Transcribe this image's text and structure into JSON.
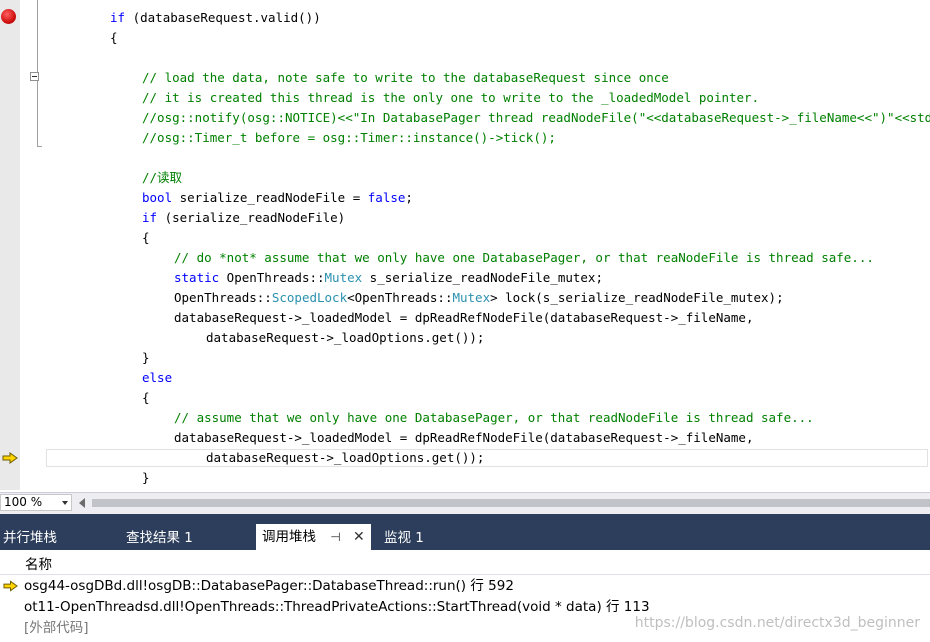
{
  "editor": {
    "lines": [
      {
        "indent": 64,
        "segments": [
          {
            "t": "if",
            "c": "kw"
          },
          {
            "t": " (databaseRequest.valid())"
          }
        ]
      },
      {
        "indent": 64,
        "segments": [
          {
            "t": "{"
          }
        ]
      },
      {
        "indent": 0,
        "segments": []
      },
      {
        "indent": 96,
        "segments": [
          {
            "t": "// load the data, note safe to write to the databaseRequest since once",
            "c": "cm"
          }
        ]
      },
      {
        "indent": 96,
        "segments": [
          {
            "t": "// it is created this thread is the only one to write to the _loadedModel pointer.",
            "c": "cm"
          }
        ]
      },
      {
        "indent": 96,
        "segments": [
          {
            "t": "//osg::notify(osg::NOTICE)<<\"In DatabasePager thread readNodeFile(\"<<databaseRequest->_fileName<<\")\"<<std::endl;",
            "c": "cm"
          }
        ]
      },
      {
        "indent": 96,
        "segments": [
          {
            "t": "//osg::Timer_t before = osg::Timer::instance()->tick();",
            "c": "cm"
          }
        ]
      },
      {
        "indent": 0,
        "segments": []
      },
      {
        "indent": 96,
        "segments": [
          {
            "t": "//读取",
            "c": "cm"
          }
        ]
      },
      {
        "indent": 96,
        "segments": [
          {
            "t": "bool",
            "c": "kw"
          },
          {
            "t": " serialize_readNodeFile = "
          },
          {
            "t": "false",
            "c": "kw"
          },
          {
            "t": ";"
          }
        ]
      },
      {
        "indent": 96,
        "segments": [
          {
            "t": "if",
            "c": "kw"
          },
          {
            "t": " (serialize_readNodeFile)"
          }
        ]
      },
      {
        "indent": 96,
        "segments": [
          {
            "t": "{"
          }
        ]
      },
      {
        "indent": 128,
        "segments": [
          {
            "t": "// do *not* assume that we only have one DatabasePager, or that reaNodeFile is thread safe...",
            "c": "cm"
          }
        ]
      },
      {
        "indent": 128,
        "segments": [
          {
            "t": "static",
            "c": "kw"
          },
          {
            "t": " OpenThreads::"
          },
          {
            "t": "Mutex",
            "c": "ty"
          },
          {
            "t": " s_serialize_readNodeFile_mutex;"
          }
        ]
      },
      {
        "indent": 128,
        "segments": [
          {
            "t": "OpenThreads::"
          },
          {
            "t": "ScopedLock",
            "c": "ty"
          },
          {
            "t": "<OpenThreads::"
          },
          {
            "t": "Mutex",
            "c": "ty"
          },
          {
            "t": "> lock(s_serialize_readNodeFile_mutex);"
          }
        ]
      },
      {
        "indent": 128,
        "segments": [
          {
            "t": "databaseRequest->_loadedModel = dpReadRefNodeFile(databaseRequest->_fileName,"
          }
        ]
      },
      {
        "indent": 160,
        "segments": [
          {
            "t": "databaseRequest->_loadOptions.get());"
          }
        ]
      },
      {
        "indent": 96,
        "segments": [
          {
            "t": "}"
          }
        ]
      },
      {
        "indent": 96,
        "segments": [
          {
            "t": "else",
            "c": "kw"
          }
        ]
      },
      {
        "indent": 96,
        "segments": [
          {
            "t": "{"
          }
        ]
      },
      {
        "indent": 128,
        "segments": [
          {
            "t": "// assume that we only have one DatabasePager, or that readNodeFile is thread safe...",
            "c": "cm"
          }
        ]
      },
      {
        "indent": 128,
        "segments": [
          {
            "t": "databaseRequest->_loadedModel = dpReadRefNodeFile(databaseRequest->_fileName,"
          }
        ]
      },
      {
        "indent": 160,
        "segments": [
          {
            "t": "databaseRequest->_loadOptions.get());"
          }
        ]
      },
      {
        "indent": 96,
        "segments": [
          {
            "t": "}"
          }
        ]
      }
    ],
    "current_line_index": 22,
    "breakpoint_line_index": 0
  },
  "zoom": {
    "value": "100 %"
  },
  "tool_tabs": [
    {
      "label": "并行堆栈"
    },
    {
      "label": "查找结果 1"
    },
    {
      "label": "调用堆栈"
    },
    {
      "label": "监视 1"
    }
  ],
  "call_stack": {
    "column_header": "名称",
    "rows": [
      {
        "text": "osg44-osgDBd.dll!osgDB::DatabasePager::DatabaseThread::run() 行 592",
        "current": true
      },
      {
        "text": "ot11-OpenThreadsd.dll!OpenThreads::ThreadPrivateActions::StartThread(void * data) 行 113",
        "current": false
      },
      {
        "text": "[外部代码]",
        "current": false,
        "external": true
      }
    ]
  },
  "watermark": "https://blog.csdn.net/directx3d_beginner",
  "colors": {
    "keyword": "#0000ff",
    "type": "#2b91af",
    "comment": "#008000",
    "tab_bar": "#2d3e5c"
  }
}
